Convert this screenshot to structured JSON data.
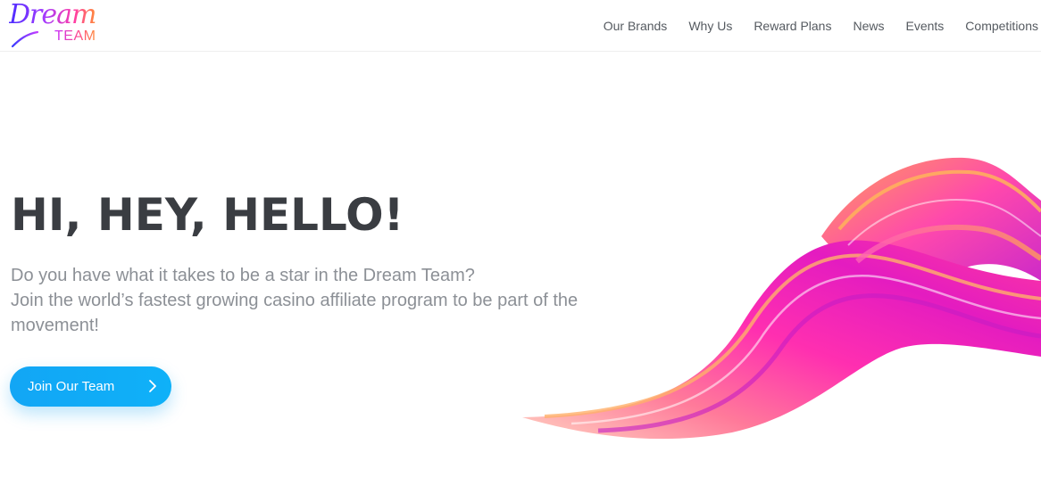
{
  "brand": {
    "logo_script": "Dream",
    "logo_sub": "TEAM"
  },
  "nav": {
    "items": [
      {
        "label": "Our Brands"
      },
      {
        "label": "Why Us"
      },
      {
        "label": "Reward Plans"
      },
      {
        "label": "News"
      },
      {
        "label": "Events"
      },
      {
        "label": "Competitions"
      }
    ]
  },
  "hero": {
    "title": "HI, HEY, HELLO!",
    "lines": [
      "Do you have what it takes to be a star in the Dream Team?",
      "Join the world’s fastest growing casino affiliate program to be part of the",
      "movement!"
    ],
    "cta_label": "Join Our Team"
  },
  "colors": {
    "title": "#3a3d42",
    "body_text": "#8c9096",
    "nav_text": "#555a60",
    "cta": "#12a6f5",
    "swirl_primary": "#ff2fb0",
    "swirl_secondary": "#ff8a4a"
  },
  "icons": {
    "cta_icon": "chevron-right-icon",
    "decor": "color-swirl-graphic"
  }
}
